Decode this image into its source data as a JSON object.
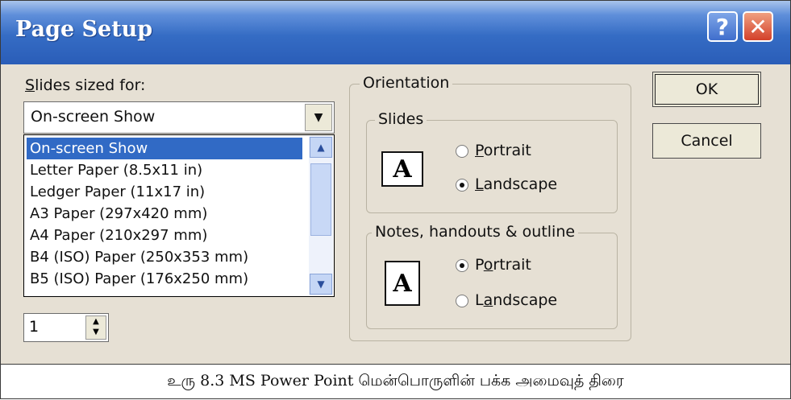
{
  "dialog": {
    "title": "Page Setup",
    "help_glyph": "?",
    "close_glyph": "✕",
    "slides_sized_for": {
      "label_accel": "S",
      "label_rest": "lides sized for:",
      "selected": "On-screen Show",
      "options": [
        "On-screen Show",
        "Letter Paper (8.5x11 in)",
        "Ledger Paper (11x17 in)",
        "A3 Paper (297x420 mm)",
        "A4 Paper (210x297 mm)",
        "B4 (ISO) Paper (250x353 mm)",
        "B5 (ISO) Paper (176x250 mm)"
      ]
    },
    "number_slides_from": "1",
    "orientation": {
      "title": "Orientation",
      "slides": {
        "title": "Slides",
        "icon_letter": "A",
        "portrait_accel": "P",
        "portrait_rest": "ortrait",
        "landscape_accel": "L",
        "landscape_rest": "andscape",
        "selected": "Landscape"
      },
      "notes": {
        "title": "Notes, handouts & outline",
        "icon_letter": "A",
        "portrait_pre": "P",
        "portrait_accel": "o",
        "portrait_rest": "rtrait",
        "landscape_pre": "L",
        "landscape_accel": "a",
        "landscape_rest": "ndscape",
        "selected": "Portrait"
      }
    },
    "buttons": {
      "ok": "OK",
      "cancel": "Cancel"
    }
  },
  "caption": "உரு 8.3 MS Power Point மென்பொருளின் பக்க அமைவுத் திரை"
}
